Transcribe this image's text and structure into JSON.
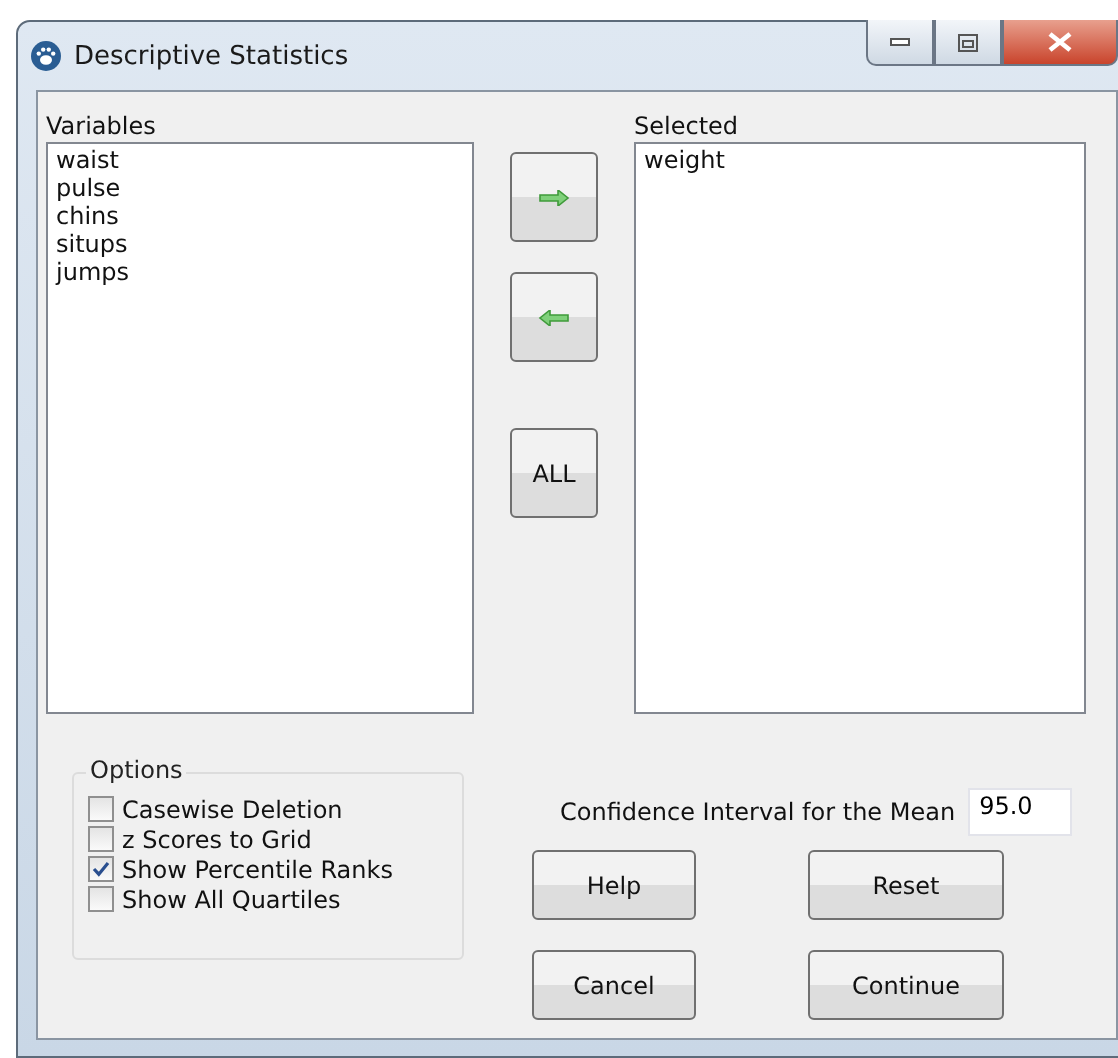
{
  "window": {
    "title": "Descriptive Statistics"
  },
  "variables": {
    "label": "Variables",
    "items": [
      "waist",
      "pulse",
      "chins",
      "situps",
      "jumps"
    ]
  },
  "move_buttons": [
    {
      "kind": "right"
    },
    {
      "kind": "left"
    },
    {
      "kind": "text",
      "label": "ALL"
    }
  ],
  "selected": {
    "label": "Selected",
    "items": [
      "weight"
    ]
  },
  "options": {
    "title": "Options",
    "items": [
      {
        "label": "Casewise Deletion",
        "checked": false
      },
      {
        "label": "z Scores to Grid",
        "checked": false
      },
      {
        "label": "Show Percentile Ranks",
        "checked": true
      },
      {
        "label": "Show All Quartiles",
        "checked": false
      }
    ]
  },
  "confidence": {
    "label": "Confidence Interval for the Mean",
    "value": "95.0"
  },
  "buttons": [
    "Help",
    "Reset",
    "Cancel",
    "Continue"
  ]
}
